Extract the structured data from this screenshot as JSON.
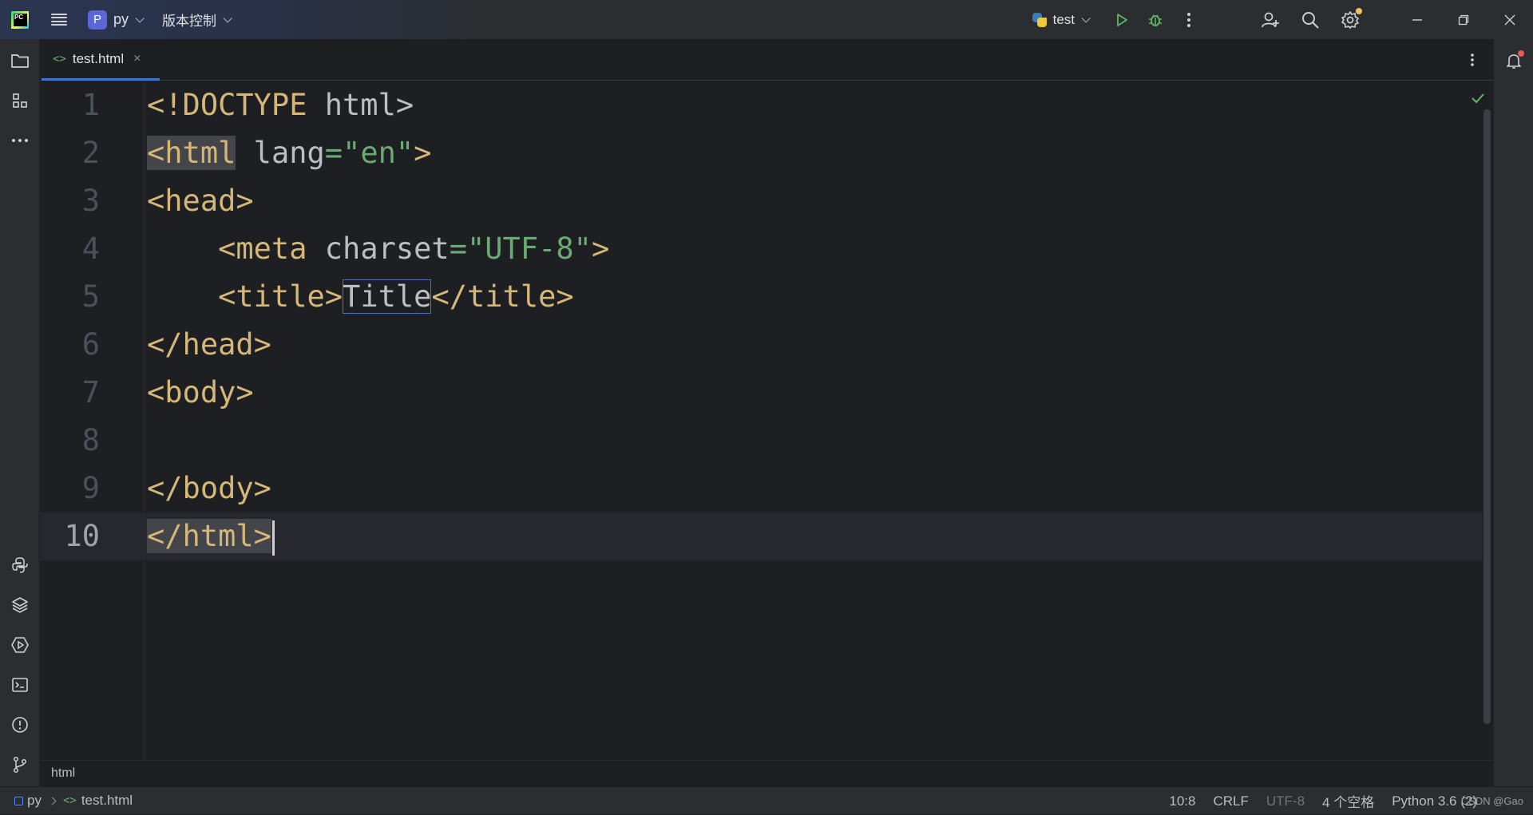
{
  "titlebar": {
    "project_badge": "P",
    "project_name": "py",
    "vcs_label": "版本控制",
    "run_config": "test"
  },
  "tabs": [
    {
      "icon": "<>",
      "label": "test.html",
      "close": "×"
    }
  ],
  "editor": {
    "lines": [
      {
        "num": "1"
      },
      {
        "num": "2"
      },
      {
        "num": "3"
      },
      {
        "num": "4"
      },
      {
        "num": "5"
      },
      {
        "num": "6"
      },
      {
        "num": "7"
      },
      {
        "num": "8"
      },
      {
        "num": "9"
      },
      {
        "num": "10"
      }
    ],
    "tokens": {
      "l1_tag": "<!DOCTYPE",
      "l1_rest": " html>",
      "l2_open": "<html",
      "l2_attr": " lang",
      "l2_eq": "=",
      "l2_val": "\"en\"",
      "l2_close": ">",
      "l3_tag": "<head>",
      "l4_indent": "    ",
      "l4_open": "<meta",
      "l4_attr": " charset",
      "l4_eq": "=",
      "l4_val": "\"UTF-8\"",
      "l4_close": ">",
      "l5_indent": "    ",
      "l5_open": "<title>",
      "l5_text": "Title",
      "l5_close": "</title>",
      "l6_tag": "</head>",
      "l7_tag": "<body>",
      "l9_tag": "</body>",
      "l10_tag": "</html>"
    }
  },
  "breadcrumb": "html",
  "statusbar": {
    "project": "py",
    "file_icon": "<>",
    "file": "test.html",
    "position": "10:8",
    "line_sep": "CRLF",
    "encoding": "UTF-8",
    "indent": "4 个空格",
    "interpreter": "Python 3.6 (2)",
    "watermark": "CSDN @Gao"
  },
  "colors": {
    "accent": "#3574f0",
    "tag": "#d5b778",
    "string": "#6aab73",
    "text": "#bcbec4",
    "notification_dot": "#e55b5b",
    "settings_dot": "#f2c55c"
  }
}
